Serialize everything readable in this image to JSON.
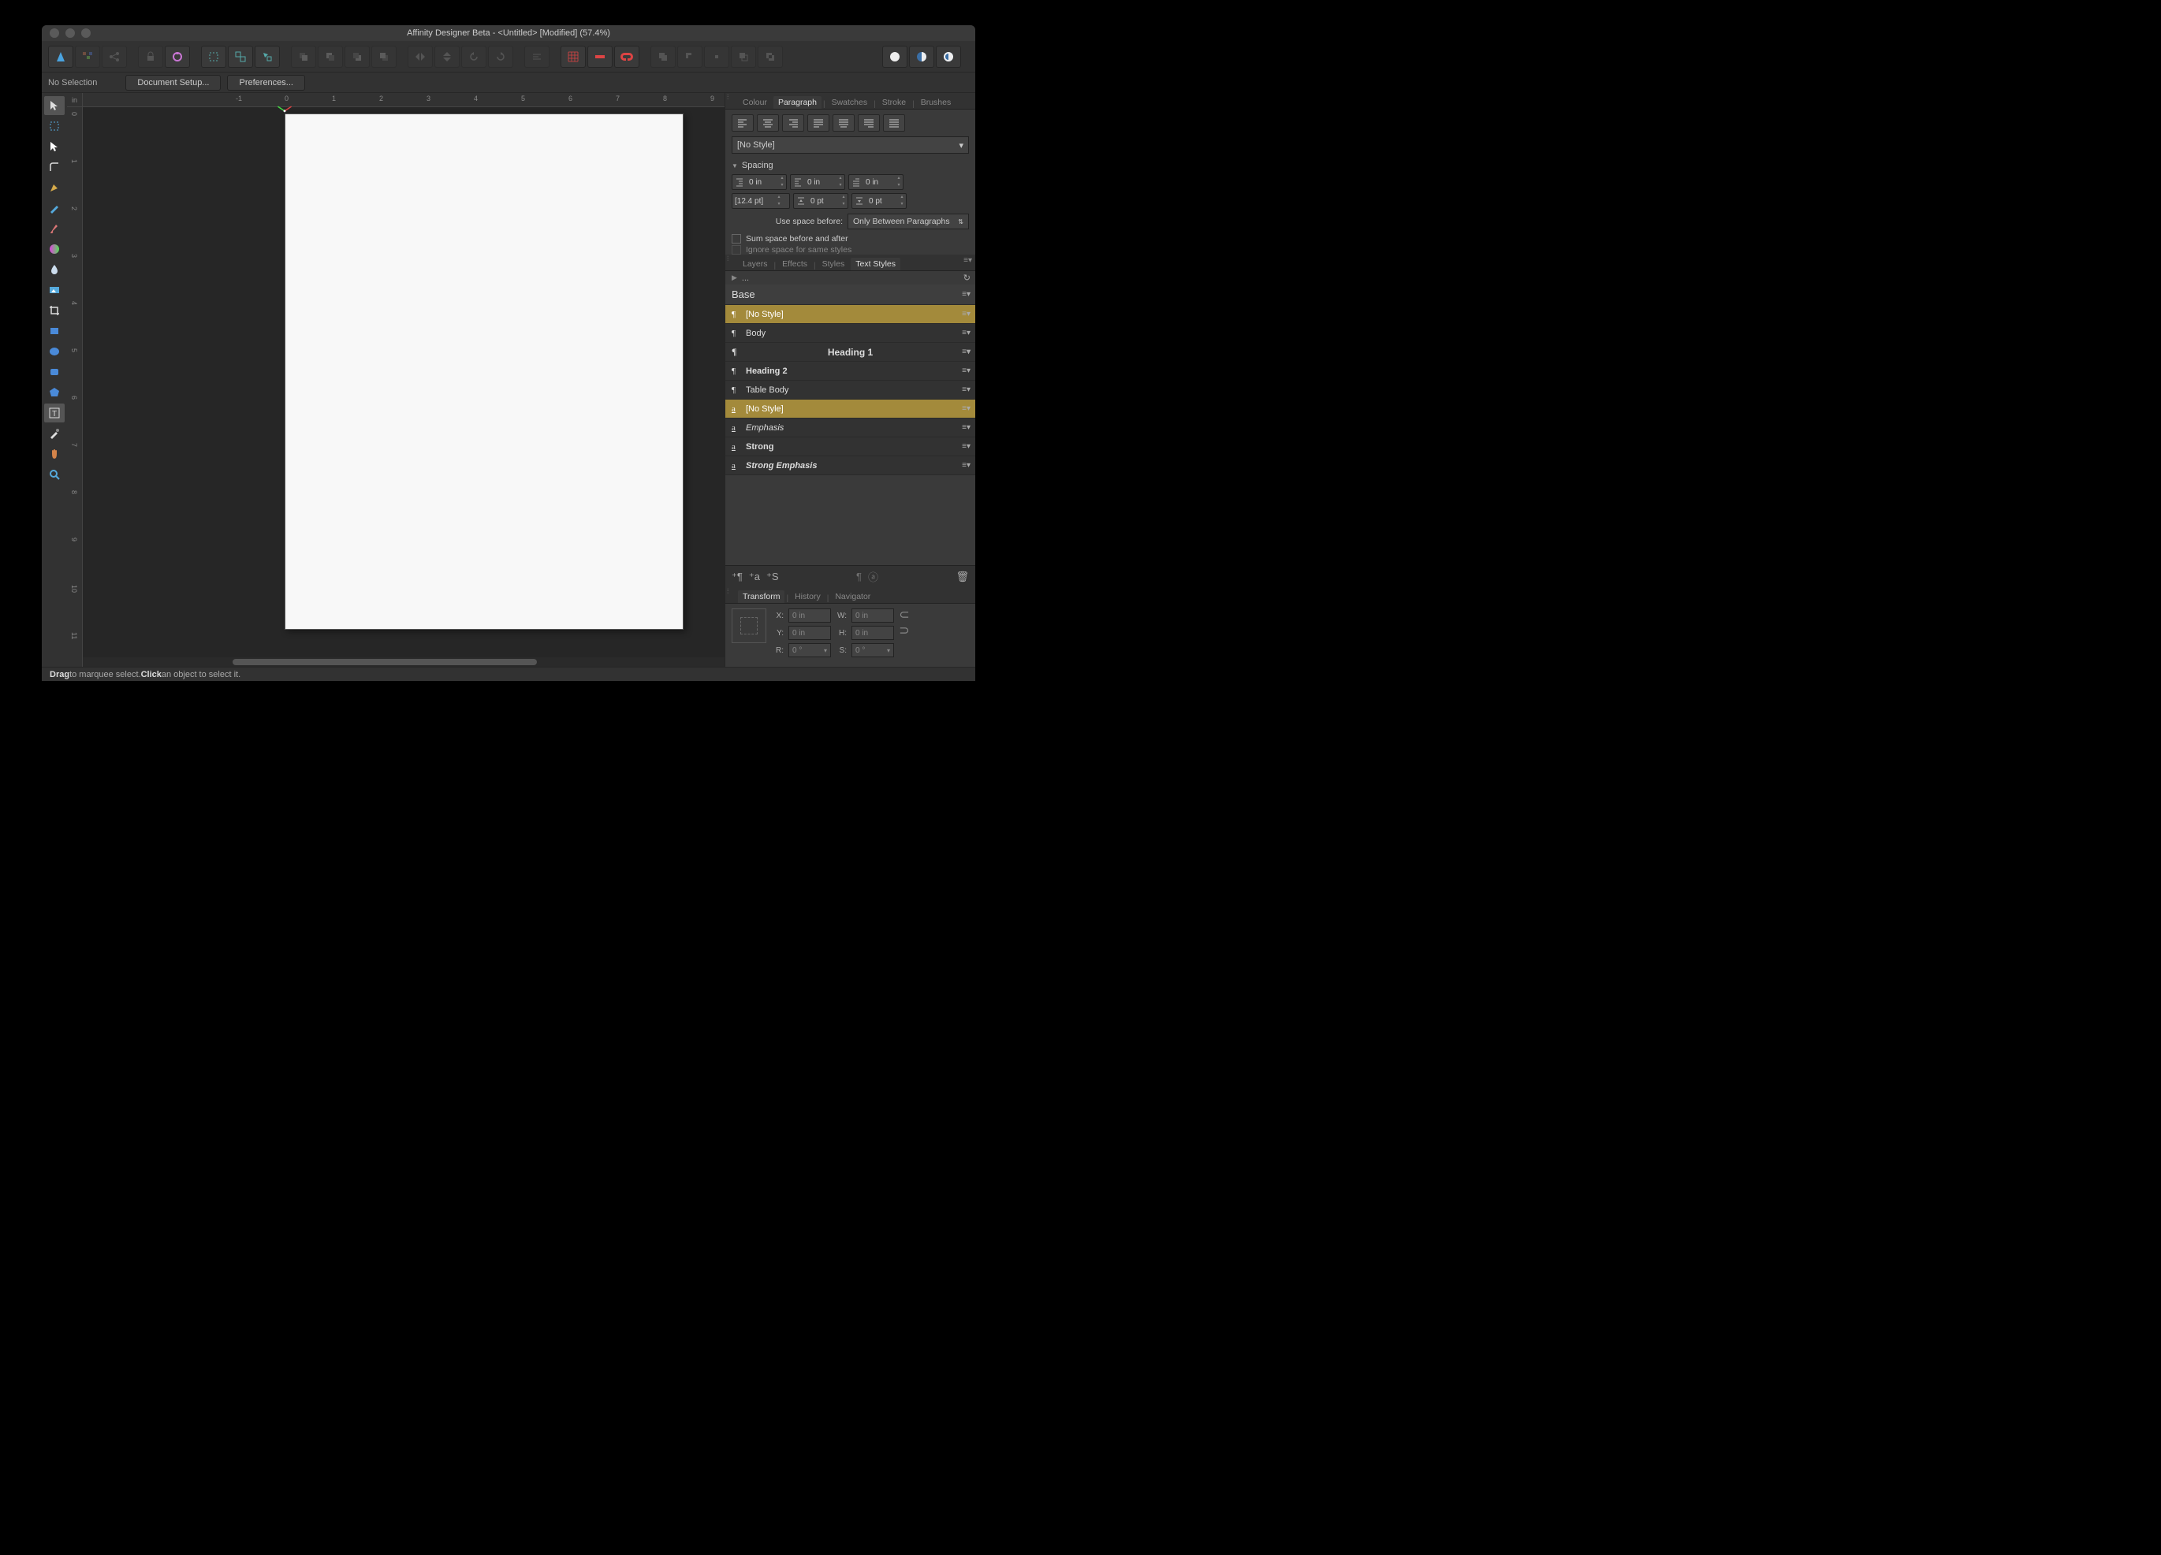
{
  "titlebar": {
    "text": "Affinity Designer Beta - <Untitled> [Modified] (57.4%)"
  },
  "context": {
    "no_selection": "No Selection",
    "doc_setup": "Document Setup...",
    "prefs": "Preferences..."
  },
  "ruler": {
    "unit": "in",
    "h_ticks": [
      "-1",
      "0",
      "1",
      "2",
      "3",
      "4",
      "5",
      "6",
      "7",
      "8",
      "9"
    ],
    "v_ticks": [
      "0",
      "1",
      "2",
      "3",
      "4",
      "5",
      "6",
      "7",
      "8",
      "9",
      "10",
      "11"
    ]
  },
  "right": {
    "panel1_tabs": [
      "Colour",
      "Paragraph",
      "Swatches",
      "Stroke",
      "Brushes"
    ],
    "panel1_active": 1,
    "style_select": "[No Style]",
    "spacing_label": "Spacing",
    "spacing": {
      "left": "0 in",
      "right": "0 in",
      "first": "0 in",
      "leading": "[12.4 pt]",
      "before": "0 pt",
      "after": "0 pt"
    },
    "use_space_label": "Use space before:",
    "use_space_value": "Only Between Paragraphs",
    "sum_space": "Sum space before and after",
    "ignore_space": "Ignore space for same styles",
    "panel2_tabs": [
      "Layers",
      "Effects",
      "Styles",
      "Text Styles"
    ],
    "panel2_active": 3,
    "ellipsis": "...",
    "styles": {
      "base": "Base",
      "nostyle1": "[No Style]",
      "body": "Body",
      "h1": "Heading 1",
      "h2": "Heading 2",
      "table": "Table Body",
      "nostyle2": "[No Style]",
      "emphasis": "Emphasis",
      "strong": "Strong",
      "strong_emph": "Strong Emphasis"
    },
    "panel3_tabs": [
      "Transform",
      "History",
      "Navigator"
    ],
    "panel3_active": 0,
    "transform": {
      "x_lbl": "X:",
      "x": "0 in",
      "y_lbl": "Y:",
      "y": "0 in",
      "w_lbl": "W:",
      "w": "0 in",
      "h_lbl": "H:",
      "h": "0 in",
      "r_lbl": "R:",
      "r": "0 °",
      "s_lbl": "S:",
      "s": "0 °"
    }
  },
  "status": {
    "drag": "Drag",
    "t1": " to marquee select. ",
    "click": "Click",
    "t2": " an object to select it."
  }
}
